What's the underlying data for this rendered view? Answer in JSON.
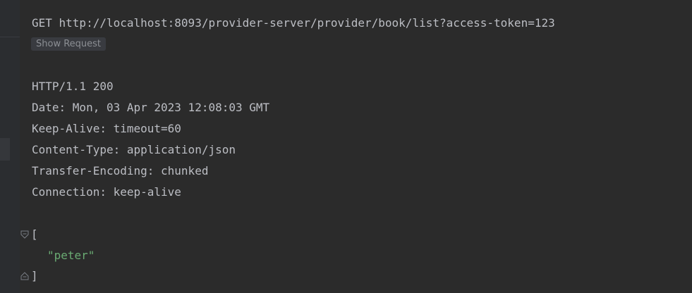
{
  "request": {
    "line": "GET http://localhost:8093/provider-server/provider/book/list?access-token=123",
    "show_request_label": "Show Request"
  },
  "response": {
    "status_line": "HTTP/1.1 200",
    "headers": [
      "Date: Mon, 03 Apr 2023 12:08:03 GMT",
      "Keep-Alive: timeout=60",
      "Content-Type: application/json",
      "Transfer-Encoding: chunked",
      "Connection: keep-alive"
    ],
    "body": {
      "open_bracket": "[",
      "items": [
        "\"peter\""
      ],
      "close_bracket": "]"
    }
  },
  "colors": {
    "background": "#2b2b2b",
    "text": "#bcbec4",
    "string": "#6aab73",
    "button_bg": "#393b40"
  },
  "icons": [
    "fold-open-icon",
    "fold-close-icon"
  ]
}
